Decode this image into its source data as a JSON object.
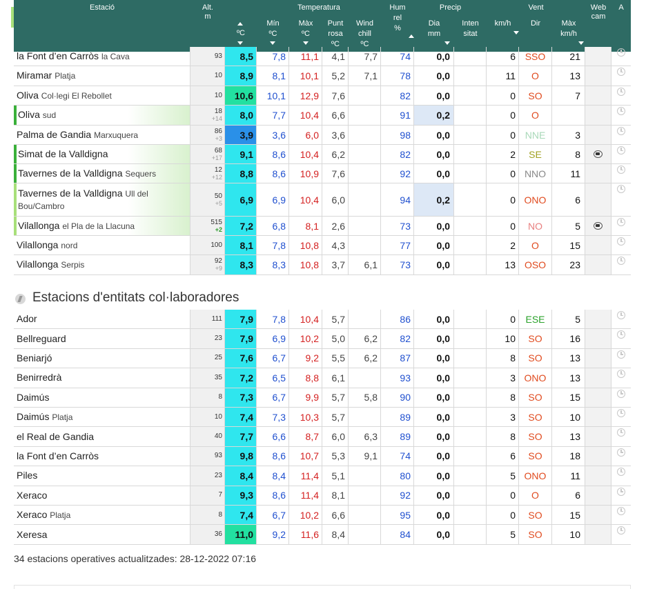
{
  "header": {
    "estacio": "Estació",
    "alt_1": "Alt.",
    "alt_2": "m",
    "temperatura": "Temperatura",
    "temp_unit": "ºC",
    "min_1": "Mín",
    "min_2": "ºC",
    "max_1": "Màx",
    "max_2": "ºC",
    "punt_1": "Punt",
    "punt_2": "rosa",
    "punt_3": "ºC",
    "wind_1": "Wind",
    "wind_2": "chill",
    "wind_3": "ºC",
    "hum_1": "Hum",
    "hum_2": "rel",
    "hum_3": "%",
    "precip": "Precip",
    "dia_1": "Dia",
    "dia_2": "mm",
    "int_1": "Inten",
    "int_2": "sitat",
    "vent": "Vent",
    "kmh": "km/h",
    "dir": "Dir",
    "max_1b": "Màx",
    "max_2b": "km/h",
    "web_1": "Web",
    "web_2": "cam",
    "a": "A"
  },
  "colors": {
    "header_bg": "#2e6b64",
    "min": "#1f4fcf",
    "max": "#d42020",
    "mark_green": "#3ab03a",
    "mark_light": "#a8e07a"
  },
  "stations": [
    {
      "name": "la Font d’en Carròs",
      "sub": "la Cava",
      "alt": "93",
      "delta": "",
      "t": "8,5",
      "tcolor": "#2fe6ee",
      "min": "7,8",
      "max": "11,1",
      "dew": "4,1",
      "wc": "7,7",
      "hum": "74",
      "pd": "0,0",
      "pi": "",
      "km": "6",
      "dir": "SSO",
      "dircolor": "#e04a1e",
      "kmax": "21",
      "cam": false,
      "mark": ""
    },
    {
      "name": "Miramar",
      "sub": "Platja",
      "alt": "10",
      "delta": "",
      "t": "8,9",
      "tcolor": "#2fe6ee",
      "min": "8,1",
      "max": "10,1",
      "dew": "5,2",
      "wc": "7,1",
      "hum": "78",
      "pd": "0,0",
      "pi": "",
      "km": "11",
      "dir": "O",
      "dircolor": "#e04a1e",
      "kmax": "13",
      "cam": false,
      "mark": ""
    },
    {
      "name": "Oliva",
      "sub": "Col·legi El Rebollet",
      "alt": "10",
      "delta": "",
      "t": "10,6",
      "tcolor": "#22e0a0",
      "min": "10,1",
      "max": "12,9",
      "dew": "7,6",
      "wc": "",
      "hum": "82",
      "pd": "0,0",
      "pi": "",
      "km": "0",
      "dir": "SO",
      "dircolor": "#e04a1e",
      "kmax": "7",
      "cam": false,
      "mark": ""
    },
    {
      "name": "Oliva",
      "sub": "sud",
      "alt": "18",
      "delta": "+14",
      "t": "8,0",
      "tcolor": "#2fe6ee",
      "min": "7,7",
      "max": "10,4",
      "dew": "6,6",
      "wc": "",
      "hum": "91",
      "pd": "0,2",
      "pi": "",
      "km": "0",
      "dir": "O",
      "dircolor": "#e04a1e",
      "kmax": "",
      "cam": false,
      "mark": "green"
    },
    {
      "name": "Palma de Gandia",
      "sub": "Marxuquera",
      "alt": "86",
      "delta": "+3",
      "t": "3,9",
      "tcolor": "#2a90e8",
      "min": "3,6",
      "max": "6,0",
      "dew": "3,6",
      "wc": "",
      "hum": "98",
      "pd": "0,0",
      "pi": "",
      "km": "0",
      "dir": "NNE",
      "dircolor": "#a8d8b8",
      "kmax": "3",
      "cam": false,
      "mark": ""
    },
    {
      "name": "Simat de la Valldigna",
      "sub": "",
      "alt": "68",
      "delta": "+17",
      "t": "9,1",
      "tcolor": "#2fe6ee",
      "min": "8,6",
      "max": "10,4",
      "dew": "6,2",
      "wc": "",
      "hum": "82",
      "pd": "0,0",
      "pi": "",
      "km": "2",
      "dir": "SE",
      "dircolor": "#a0a020",
      "kmax": "8",
      "cam": true,
      "mark": "green"
    },
    {
      "name": "Tavernes de la Valldigna",
      "sub": "Sequers",
      "alt": "12",
      "delta": "+12",
      "t": "8,8",
      "tcolor": "#2fe6ee",
      "min": "8,6",
      "max": "10,9",
      "dew": "7,6",
      "wc": "",
      "hum": "92",
      "pd": "0,0",
      "pi": "",
      "km": "0",
      "dir": "NNO",
      "dircolor": "#888888",
      "kmax": "11",
      "cam": false,
      "mark": "green"
    },
    {
      "name": "Tavernes de la Valldigna",
      "sub": "Ull del Bou/Cambro",
      "alt": "50",
      "delta": "+5",
      "t": "6,9",
      "tcolor": "#2fe6ee",
      "min": "6,9",
      "max": "10,4",
      "dew": "6,0",
      "wc": "",
      "hum": "94",
      "pd": "0,2",
      "pi": "",
      "km": "0",
      "dir": "ONO",
      "dircolor": "#e04a1e",
      "kmax": "6",
      "cam": false,
      "mark": "light"
    },
    {
      "name": "Vilallonga",
      "sub": "el Pla de la Llacuna",
      "alt": "515",
      "delta": "+2",
      "t": "7,2",
      "tcolor": "#2fe6ee",
      "min": "6,8",
      "max": "8,1",
      "dew": "2,6",
      "wc": "",
      "hum": "73",
      "pd": "0,0",
      "pi": "",
      "km": "0",
      "dir": "NO",
      "dircolor": "#e88080",
      "kmax": "5",
      "cam": true,
      "mark": "light"
    },
    {
      "name": "Vilallonga",
      "sub": "nord",
      "alt": "100",
      "delta": "",
      "t": "8,1",
      "tcolor": "#2fe6ee",
      "min": "7,8",
      "max": "10,8",
      "dew": "4,3",
      "wc": "",
      "hum": "77",
      "pd": "0,0",
      "pi": "",
      "km": "2",
      "dir": "O",
      "dircolor": "#e04a1e",
      "kmax": "15",
      "cam": false,
      "mark": ""
    },
    {
      "name": "Vilallonga",
      "sub": "Serpis",
      "alt": "92",
      "delta": "+9",
      "t": "8,3",
      "tcolor": "#2fe6ee",
      "min": "8,3",
      "max": "10,8",
      "dew": "3,7",
      "wc": "6,1",
      "hum": "73",
      "pd": "0,0",
      "pi": "",
      "km": "13",
      "dir": "OSO",
      "dircolor": "#e04a1e",
      "kmax": "23",
      "cam": false,
      "mark": ""
    }
  ],
  "section_title": "Estacions d'entitats col·laboradores",
  "collab": [
    {
      "name": "Ador",
      "sub": "",
      "alt": "111",
      "delta": "",
      "t": "7,9",
      "tcolor": "#2fe6ee",
      "min": "7,8",
      "max": "10,4",
      "dew": "5,7",
      "wc": "",
      "hum": "86",
      "pd": "0,0",
      "pi": "",
      "km": "0",
      "dir": "ESE",
      "dircolor": "#2aa22a",
      "kmax": "5",
      "cam": false,
      "mark": ""
    },
    {
      "name": "Bellreguard",
      "sub": "",
      "alt": "23",
      "delta": "",
      "t": "7,9",
      "tcolor": "#2fe6ee",
      "min": "6,9",
      "max": "10,2",
      "dew": "5,0",
      "wc": "6,2",
      "hum": "82",
      "pd": "0,0",
      "pi": "",
      "km": "10",
      "dir": "SO",
      "dircolor": "#e04a1e",
      "kmax": "16",
      "cam": false,
      "mark": ""
    },
    {
      "name": "Beniarjó",
      "sub": "",
      "alt": "25",
      "delta": "",
      "t": "7,6",
      "tcolor": "#2fe6ee",
      "min": "6,7",
      "max": "9,2",
      "dew": "5,5",
      "wc": "6,2",
      "hum": "87",
      "pd": "0,0",
      "pi": "",
      "km": "8",
      "dir": "SO",
      "dircolor": "#e04a1e",
      "kmax": "13",
      "cam": false,
      "mark": ""
    },
    {
      "name": "Benirredrà",
      "sub": "",
      "alt": "35",
      "delta": "",
      "t": "7,2",
      "tcolor": "#2fe6ee",
      "min": "6,5",
      "max": "8,8",
      "dew": "6,1",
      "wc": "",
      "hum": "93",
      "pd": "0,0",
      "pi": "",
      "km": "3",
      "dir": "ONO",
      "dircolor": "#e04a1e",
      "kmax": "13",
      "cam": false,
      "mark": ""
    },
    {
      "name": "Daimús",
      "sub": "",
      "alt": "8",
      "delta": "",
      "t": "7,3",
      "tcolor": "#2fe6ee",
      "min": "6,7",
      "max": "9,9",
      "dew": "5,7",
      "wc": "5,8",
      "hum": "90",
      "pd": "0,0",
      "pi": "",
      "km": "8",
      "dir": "SO",
      "dircolor": "#e04a1e",
      "kmax": "15",
      "cam": false,
      "mark": ""
    },
    {
      "name": "Daimús",
      "sub": "Platja",
      "alt": "10",
      "delta": "",
      "t": "7,4",
      "tcolor": "#2fe6ee",
      "min": "7,3",
      "max": "10,3",
      "dew": "5,7",
      "wc": "",
      "hum": "89",
      "pd": "0,0",
      "pi": "",
      "km": "3",
      "dir": "SO",
      "dircolor": "#e04a1e",
      "kmax": "10",
      "cam": false,
      "mark": ""
    },
    {
      "name": "el Real de Gandia",
      "sub": "",
      "alt": "40",
      "delta": "",
      "t": "7,7",
      "tcolor": "#2fe6ee",
      "min": "6,6",
      "max": "8,7",
      "dew": "6,0",
      "wc": "6,3",
      "hum": "89",
      "pd": "0,0",
      "pi": "",
      "km": "8",
      "dir": "SO",
      "dircolor": "#e04a1e",
      "kmax": "13",
      "cam": false,
      "mark": ""
    },
    {
      "name": "la Font d’en Carròs",
      "sub": "",
      "alt": "93",
      "delta": "",
      "t": "9,8",
      "tcolor": "#2fe6ee",
      "min": "8,6",
      "max": "10,7",
      "dew": "5,3",
      "wc": "9,1",
      "hum": "74",
      "pd": "0,0",
      "pi": "",
      "km": "6",
      "dir": "SO",
      "dircolor": "#e04a1e",
      "kmax": "18",
      "cam": false,
      "mark": ""
    },
    {
      "name": "Piles",
      "sub": "",
      "alt": "23",
      "delta": "",
      "t": "8,4",
      "tcolor": "#2fe6ee",
      "min": "8,4",
      "max": "11,4",
      "dew": "5,1",
      "wc": "",
      "hum": "80",
      "pd": "0,0",
      "pi": "",
      "km": "5",
      "dir": "ONO",
      "dircolor": "#e04a1e",
      "kmax": "11",
      "cam": false,
      "mark": ""
    },
    {
      "name": "Xeraco",
      "sub": "",
      "alt": "7",
      "delta": "",
      "t": "9,3",
      "tcolor": "#2fe6ee",
      "min": "8,6",
      "max": "11,4",
      "dew": "8,1",
      "wc": "",
      "hum": "92",
      "pd": "0,0",
      "pi": "",
      "km": "0",
      "dir": "O",
      "dircolor": "#e04a1e",
      "kmax": "6",
      "cam": false,
      "mark": ""
    },
    {
      "name": "Xeraco",
      "sub": "Platja",
      "alt": "8",
      "delta": "",
      "t": "7,4",
      "tcolor": "#2fe6ee",
      "min": "6,7",
      "max": "10,2",
      "dew": "6,6",
      "wc": "",
      "hum": "95",
      "pd": "0,0",
      "pi": "",
      "km": "0",
      "dir": "SO",
      "dircolor": "#e04a1e",
      "kmax": "15",
      "cam": false,
      "mark": ""
    },
    {
      "name": "Xeresa",
      "sub": "",
      "alt": "36",
      "delta": "",
      "t": "11,0",
      "tcolor": "#22e0a0",
      "min": "9,2",
      "max": "11,6",
      "dew": "8,4",
      "wc": "",
      "hum": "84",
      "pd": "0,0",
      "pi": "",
      "km": "5",
      "dir": "SO",
      "dircolor": "#e04a1e",
      "kmax": "10",
      "cam": false,
      "mark": ""
    }
  ],
  "footer": {
    "count_label": "34 estacions operatives actualitzades:",
    "timestamp": "28-12-2022 07:16"
  }
}
